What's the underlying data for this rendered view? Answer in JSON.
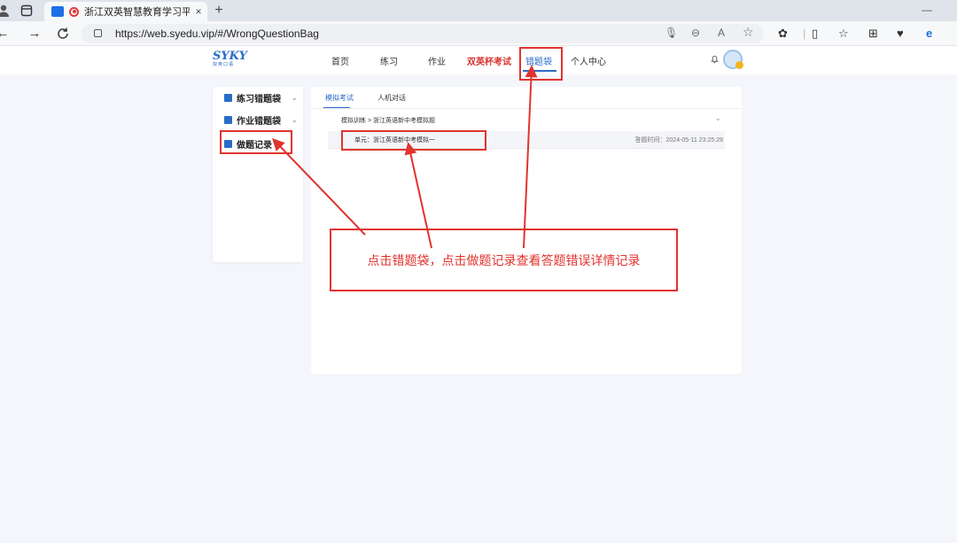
{
  "browser": {
    "tab_title": "浙江双英智慧教育学习平台",
    "tab_close": "×",
    "new_tab": "+",
    "minimize": "—",
    "url": "https://web.syedu.vip/#/WrongQuestionBag",
    "icons": [
      "profile-icon",
      "tab-actions-icon",
      "back-icon",
      "forward-icon",
      "refresh-icon",
      "lock-icon",
      "mic-icon",
      "zoom-icon",
      "read-aloud-icon",
      "favorite-icon",
      "extensions-icon",
      "split-screen-icon",
      "favorites-icon",
      "collections-icon",
      "performance-icon",
      "edge-icon"
    ]
  },
  "site": {
    "logo_text": "SYKY",
    "logo_sub": "双英口语",
    "nav": [
      {
        "label": "首页"
      },
      {
        "label": "练习"
      },
      {
        "label": "作业"
      },
      {
        "label": "双英杯考试"
      },
      {
        "label": "错题袋"
      },
      {
        "label": "个人中心"
      }
    ],
    "active_nav": "错题袋",
    "accent_color": "#2a6cc8",
    "highlight_color": "#d8322e"
  },
  "sidebar": {
    "items": [
      {
        "label": "练习错题袋",
        "chevron": "⌄"
      },
      {
        "label": "作业错题袋",
        "chevron": "⌄"
      },
      {
        "label": "做题记录"
      }
    ]
  },
  "panel": {
    "tabs": [
      {
        "label": "模拟考试"
      },
      {
        "label": "人机对话"
      }
    ],
    "breadcrumb": "模拟训练 > 浙江英语新中考模拟题",
    "record": {
      "unit": "单元：浙江英语新中考模拟一",
      "time": "答题时间：2024-05-11 23:25:28"
    }
  },
  "annotation": {
    "text": "点击错题袋，点击做题记录查看答题错误详情记录",
    "color": "#e0342f"
  }
}
